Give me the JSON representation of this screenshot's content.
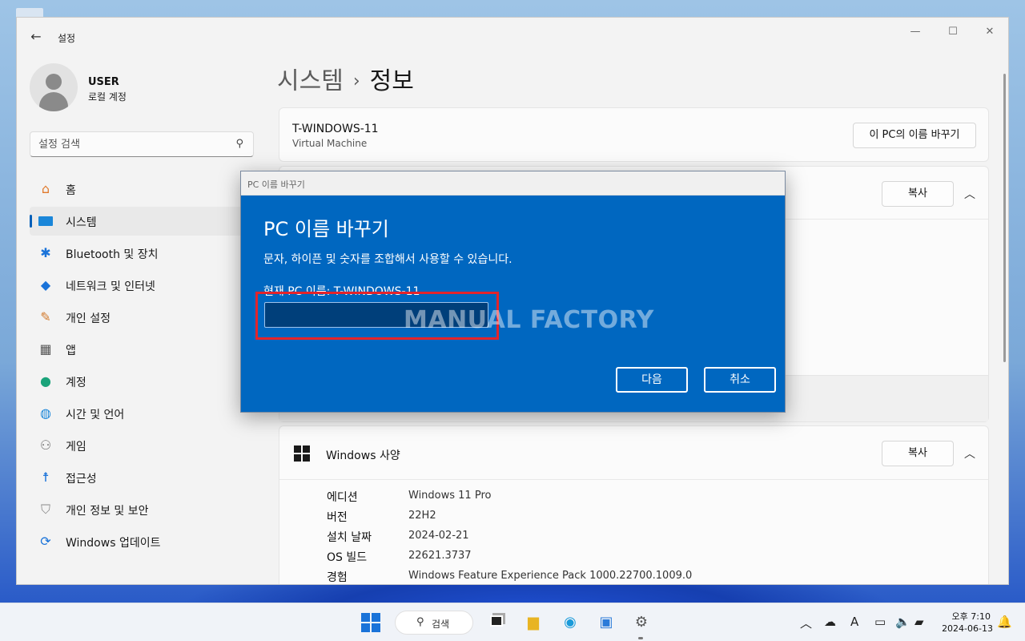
{
  "window": {
    "title": "설정",
    "back_icon": "back-arrow-icon"
  },
  "user": {
    "name": "USER",
    "account_type": "로컬 계정"
  },
  "search": {
    "placeholder": "설정 검색"
  },
  "nav": {
    "items": [
      {
        "label": "홈",
        "icon": "home-icon"
      },
      {
        "label": "시스템",
        "icon": "system-icon",
        "active": true
      },
      {
        "label": "Bluetooth 및 장치",
        "icon": "bluetooth-icon"
      },
      {
        "label": "네트워크 및 인터넷",
        "icon": "wifi-icon"
      },
      {
        "label": "개인 설정",
        "icon": "brush-icon"
      },
      {
        "label": "앱",
        "icon": "apps-icon"
      },
      {
        "label": "계정",
        "icon": "account-icon"
      },
      {
        "label": "시간 및 언어",
        "icon": "globe-clock-icon"
      },
      {
        "label": "게임",
        "icon": "gamepad-icon"
      },
      {
        "label": "접근성",
        "icon": "accessibility-icon"
      },
      {
        "label": "개인 정보 및 보안",
        "icon": "shield-icon"
      },
      {
        "label": "Windows 업데이트",
        "icon": "update-icon"
      }
    ]
  },
  "breadcrumb": {
    "parent": "시스템",
    "separator": "›",
    "current": "정보"
  },
  "device_card": {
    "pc_name": "T-WINDOWS-11",
    "pc_type": "Virtual Machine",
    "rename_label": "이 PC의 이름 바꾸기"
  },
  "device_spec": {
    "copy_label": "복사"
  },
  "windows_spec": {
    "title": "Windows 사양",
    "copy_label": "복사",
    "rows": [
      {
        "key": "에디션",
        "value": "Windows 11 Pro"
      },
      {
        "key": "버전",
        "value": "22H2"
      },
      {
        "key": "설치 날짜",
        "value": "2024-02-21"
      },
      {
        "key": "OS 빌드",
        "value": "22621.3737"
      },
      {
        "key": "경험",
        "value": "Windows Feature Experience Pack 1000.22700.1009.0"
      }
    ]
  },
  "dialog": {
    "bar_title": "PC 이름 바꾸기",
    "title": "PC 이름 바꾸기",
    "description": "문자, 하이픈 및 숫자를 조합해서 사용할 수 있습니다.",
    "current_name": "현재 PC 이름: T-WINDOWS-11",
    "input_value": "",
    "next_label": "다음",
    "cancel_label": "취소",
    "watermark": "MANUAL FACTORY"
  },
  "taskbar": {
    "search_label": "검색",
    "time": "오후 7:10",
    "date": "2024-06-13"
  },
  "colors": {
    "accent": "#0067c0",
    "highlight_box": "#e3242b"
  }
}
